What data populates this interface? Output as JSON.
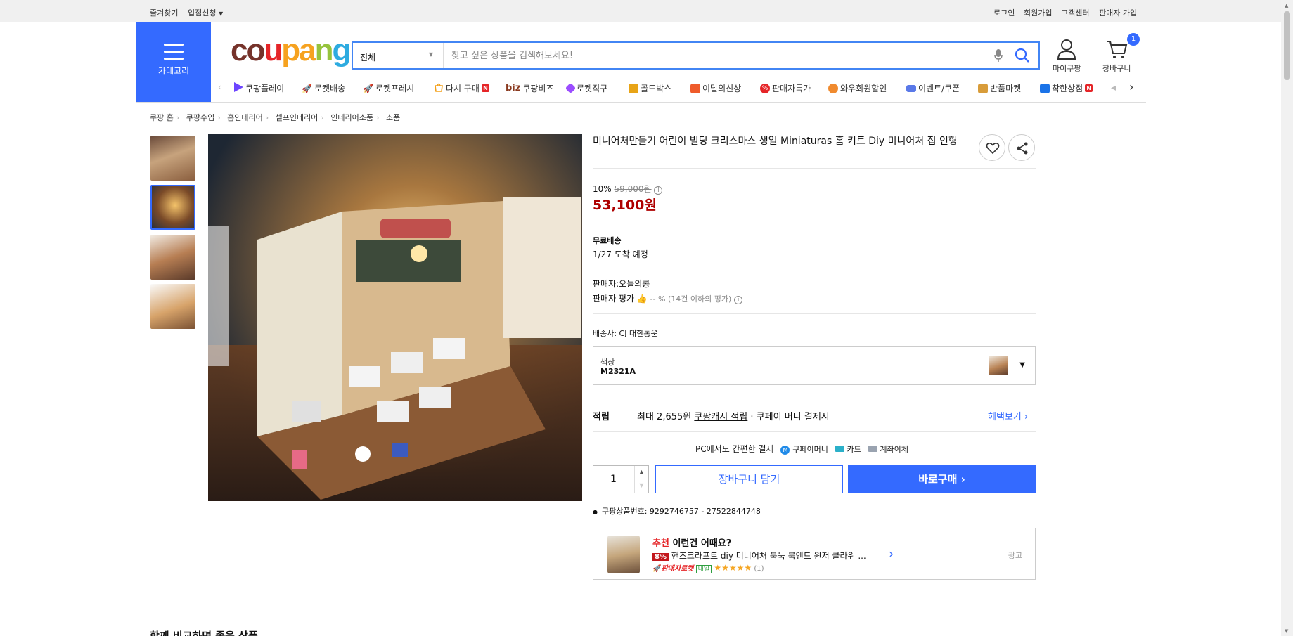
{
  "topbar": {
    "left": [
      "즐겨찾기",
      "입점신청"
    ],
    "right": [
      "로그인",
      "회원가입",
      "고객센터",
      "판매자 가입"
    ]
  },
  "header": {
    "category_label": "카테고리",
    "logo": {
      "c1": "co",
      "c2": "u",
      "c3": "pa",
      "c4": "n",
      "c5": "g"
    },
    "search": {
      "category": "전체",
      "placeholder": "찾고 싶은 상품을 검색해보세요!"
    },
    "mycoupang": "마이쿠팡",
    "cart": "장바구니",
    "cart_count": "1"
  },
  "nav": [
    {
      "label": "쿠팡플레이",
      "icon": "play-icon",
      "color": "#6d45ff"
    },
    {
      "label": "로켓배송",
      "icon": "rocket-icon",
      "color": "#346aff"
    },
    {
      "label": "로켓프레시",
      "icon": "rocket-fresh-icon",
      "color": "#2e9e3f"
    },
    {
      "label": "다시 구매",
      "icon": "rebuy-icon",
      "color": "#f4a11a"
    },
    {
      "label": "쿠팡비즈",
      "icon": "biz-icon",
      "color": "#8a3a1f"
    },
    {
      "label": "로켓직구",
      "icon": "global-icon",
      "color": "#9b4dff"
    },
    {
      "label": "골드박스",
      "icon": "goldbox-icon",
      "color": "#e8a417"
    },
    {
      "label": "이달의신상",
      "icon": "bag-icon",
      "color": "#ef5b2b"
    },
    {
      "label": "판매자특가",
      "icon": "percent-icon",
      "color": "#e52528"
    },
    {
      "label": "와우회원할인",
      "icon": "wow-icon",
      "color": "#f08a2e"
    },
    {
      "label": "이벤트/쿠폰",
      "icon": "coupon-icon",
      "color": "#5a79e8"
    },
    {
      "label": "반품마켓",
      "icon": "market-icon",
      "color": "#d89c3a"
    },
    {
      "label": "착한상점",
      "icon": "store-icon",
      "color": "#1a73e8"
    }
  ],
  "nav_biz_prefix": "biz",
  "breadcrumb": [
    "쿠팡 홈",
    "쿠팡수입",
    "홈인테리어",
    "셀프인테리어",
    "인테리어소품",
    "소품"
  ],
  "product": {
    "title": "미니어처만들기 어린이 빌딩 크리스마스 생일 Miniaturas 홈 키트 Diy 미니어처 집 인형",
    "discount": "10%",
    "original_price": "59,000원",
    "price": "53,100원",
    "shipping_title": "무료배송",
    "shipping_date": "1/27 도착 예정",
    "seller": "판매자:오늘의콩",
    "seller_rating_label": "판매자 평가",
    "seller_rating_value": "-- % (14건 이하의 평가)",
    "carrier": "배송사:  CJ 대한통운",
    "option_label": "색상",
    "option_value": "M2321A",
    "reward_label": "적립",
    "reward_prefix": "최대 2,655원",
    "reward_link": "쿠팡캐시 적립",
    "reward_suffix": "· 쿠페이 머니 결제시",
    "benefit_link": "혜택보기",
    "pay_title": "PC에서도 간편한 결제",
    "pay_methods": [
      "쿠페이머니",
      "카드",
      "계좌이체"
    ],
    "quantity": "1",
    "add_to_cart": "장바구니 담기",
    "buy_now": "바로구매",
    "product_id": "쿠팡상품번호: 9292746757 - 27522844748"
  },
  "recommend": {
    "title_highlight": "추천",
    "title_rest": " 이런건 어때요?",
    "badge": "8%",
    "name": "핸즈크라프트 diy 미니어처 북눅 북엔드 윈저 클라위 ...",
    "seller_rocket": "판매자로켓",
    "tag": "내일",
    "stars": "★★★★★",
    "review_count": "(1)",
    "ad_label": "광고"
  },
  "bottom_heading": "함께 비교하면 좋을 상품"
}
